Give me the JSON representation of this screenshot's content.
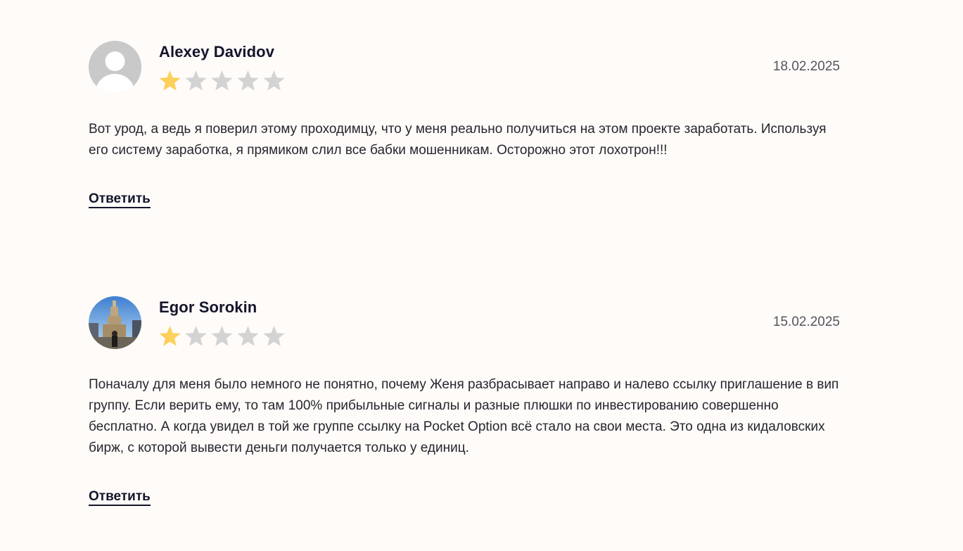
{
  "colors": {
    "background": "#fefbf8",
    "star_filled": "#fdd05b",
    "star_empty": "#d3d3d3",
    "text_dark": "#14142b"
  },
  "reviews": [
    {
      "author": "Alexey Davidov",
      "rating": 1,
      "max_rating": 5,
      "date": "18.02.2025",
      "avatar": "default-user-avatar",
      "text": "Вот урод, а ведь я поверил этому проходимцу, что у меня реально получиться на этом проекте заработать. Используя его систему заработка, я прямиком слил все бабки мошенникам. Осторожно этот лохотрон!!!",
      "reply_label": "Ответить"
    },
    {
      "author": "Egor Sorokin",
      "rating": 1,
      "max_rating": 5,
      "date": "15.02.2025",
      "avatar": "photo-avatar",
      "text": "Поначалу для меня было немного не понятно, почему Женя разбрасывает направо и налево ссылку приглашение в вип группу. Если верить ему, то там 100% прибыльные сигналы и разные плюшки по инвестированию совершенно бесплатно. А когда увидел в той же группе ссылку на Pocket Option всё стало на свои места. Это одна из кидаловских бирж, с которой вывести деньги получается только у единиц.",
      "reply_label": "Ответить"
    }
  ]
}
